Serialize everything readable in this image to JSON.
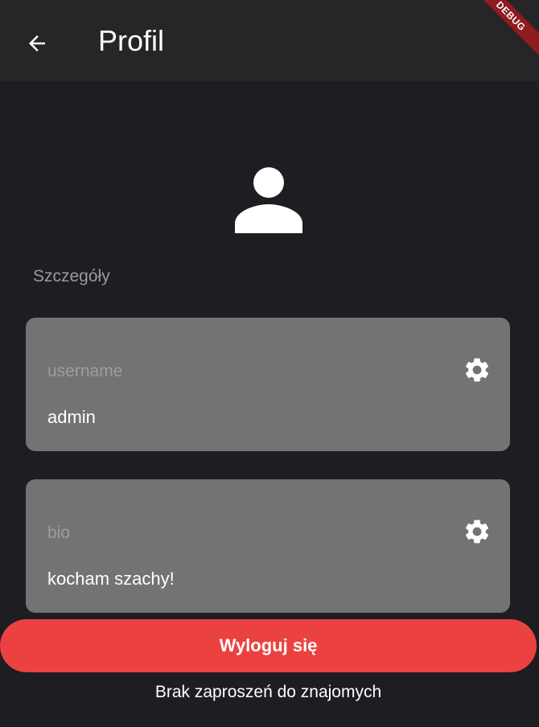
{
  "appbar": {
    "title": "Profil",
    "back_icon": "arrow-left-icon",
    "debug_banner": "DEBUG"
  },
  "profile": {
    "avatar_icon": "person-icon",
    "section_label": "Szczegóły",
    "fields": [
      {
        "label": "username",
        "value": "admin",
        "edit_icon": "gear-icon"
      },
      {
        "label": "bio",
        "value": "kocham szachy!",
        "edit_icon": "gear-icon"
      }
    ]
  },
  "actions": {
    "logout_label": "Wyloguj się"
  },
  "friends": {
    "invitations_status": "Brak zaproszeń do znajomych"
  },
  "colors": {
    "background": "#1e1d22",
    "appbar": "#262628",
    "card": "#737373",
    "accent": "#ec4141"
  }
}
